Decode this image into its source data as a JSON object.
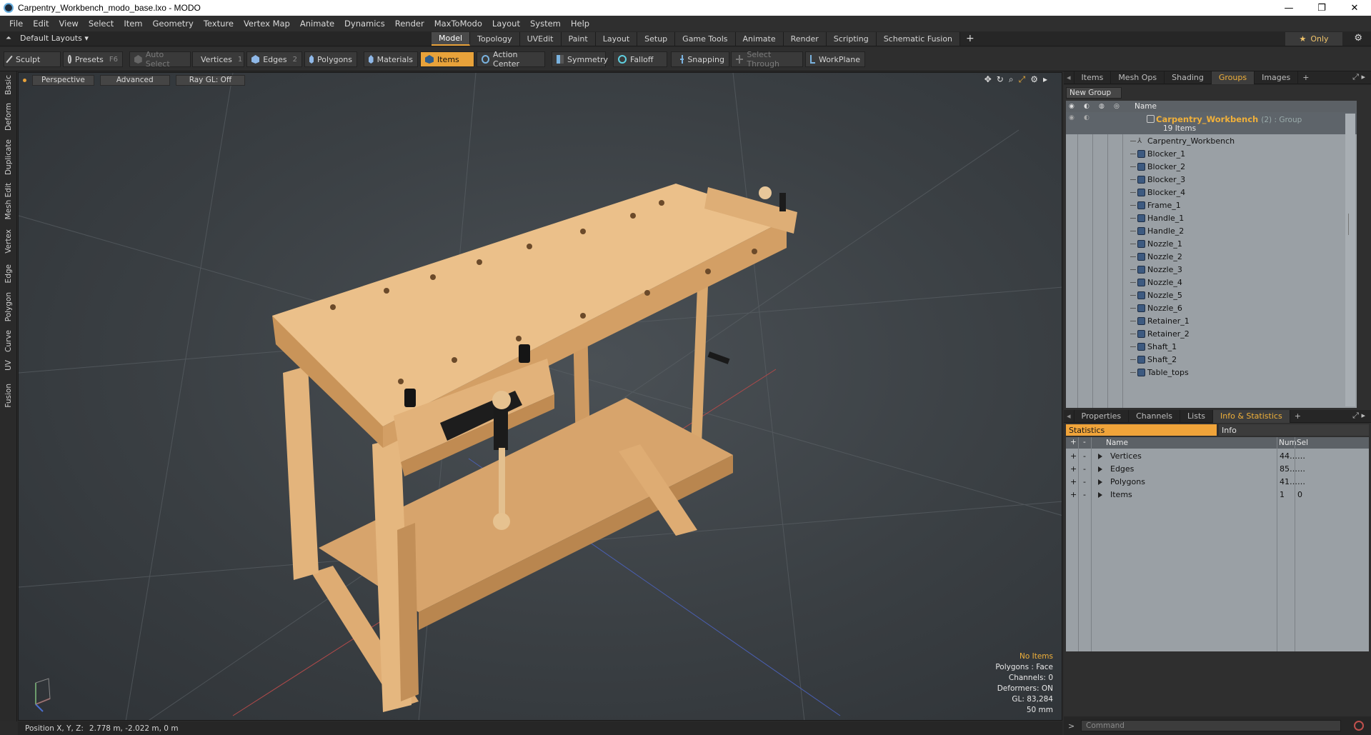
{
  "window": {
    "title": "Carpentry_Workbench_modo_base.lxo - MODO",
    "minimize": "—",
    "maximize": "❐",
    "close": "✕"
  },
  "menu": [
    "File",
    "Edit",
    "View",
    "Select",
    "Item",
    "Geometry",
    "Texture",
    "Vertex Map",
    "Animate",
    "Dynamics",
    "Render",
    "MaxToModo",
    "Layout",
    "System",
    "Help"
  ],
  "layoutbar": {
    "layout_name": "Default Layouts",
    "tabs": [
      "Model",
      "Topology",
      "UVEdit",
      "Paint",
      "Layout",
      "Setup",
      "Game Tools",
      "Animate",
      "Render",
      "Scripting",
      "Schematic Fusion"
    ],
    "active_tab": "Model",
    "only_label": "Only"
  },
  "toolbar": {
    "sculpt": "Sculpt",
    "presets": "Presets",
    "presets_key": "F6",
    "auto_select": "Auto Select",
    "vertices": "Vertices",
    "vertices_key": "1",
    "edges": "Edges",
    "edges_key": "2",
    "polygons": "Polygons",
    "materials": "Materials",
    "items": "Items",
    "action_center": "Action Center",
    "symmetry": "Symmetry",
    "falloff": "Falloff",
    "snapping": "Snapping",
    "select_through": "Select Through",
    "workplane": "WorkPlane"
  },
  "lefttabs": [
    "Basic",
    "Deform",
    "Duplicate",
    "Mesh Edit",
    "Vertex",
    "Edge",
    "Polygon",
    "Curve",
    "UV",
    "Fusion"
  ],
  "viewport": {
    "view": "Perspective",
    "shading": "Advanced",
    "raygl": "Ray GL: Off",
    "stats": {
      "selection": "No Items",
      "polygons": "Polygons : Face",
      "channels": "Channels: 0",
      "deformers": "Deformers: ON",
      "gl": "GL: 83,284",
      "scale": "50 mm"
    }
  },
  "statusbar": {
    "label": "Position X, Y, Z:",
    "value": "2.778 m, -2.022 m, 0 m"
  },
  "top_panel": {
    "tabs": [
      "Items",
      "Mesh Ops",
      "Shading",
      "Groups",
      "Images"
    ],
    "active_tab": "Groups",
    "new_group": "New Group",
    "name_header": "Name",
    "group": {
      "name": "Carpentry_Workbench",
      "type": "(2) : Group",
      "count": "19 Items"
    },
    "items": [
      "Carpentry_Workbench",
      "Blocker_1",
      "Blocker_2",
      "Blocker_3",
      "Blocker_4",
      "Frame_1",
      "Handle_1",
      "Handle_2",
      "Nozzle_1",
      "Nozzle_2",
      "Nozzle_3",
      "Nozzle_4",
      "Nozzle_5",
      "Nozzle_6",
      "Retainer_1",
      "Retainer_2",
      "Shaft_1",
      "Shaft_2",
      "Table_tops"
    ]
  },
  "bottom_panel": {
    "tabs": [
      "Properties",
      "Channels",
      "Lists",
      "Info & Statistics"
    ],
    "active_tab": "Info & Statistics",
    "subtabs": [
      "Statistics",
      "Info"
    ],
    "headers": {
      "name": "Name",
      "num": "Num",
      "sel": "Sel"
    },
    "rows": [
      {
        "name": "Vertices",
        "num": "44…",
        "sel": "…"
      },
      {
        "name": "Edges",
        "num": "85…",
        "sel": "…"
      },
      {
        "name": "Polygons",
        "num": "41…",
        "sel": "…"
      },
      {
        "name": "Items",
        "num": "1",
        "sel": "0"
      }
    ]
  },
  "command": {
    "prompt": ">",
    "placeholder": "Command"
  },
  "colors": {
    "accent": "#e8a23a",
    "wood": "#e3b47c",
    "viewport_bg": "#3a3f43"
  }
}
